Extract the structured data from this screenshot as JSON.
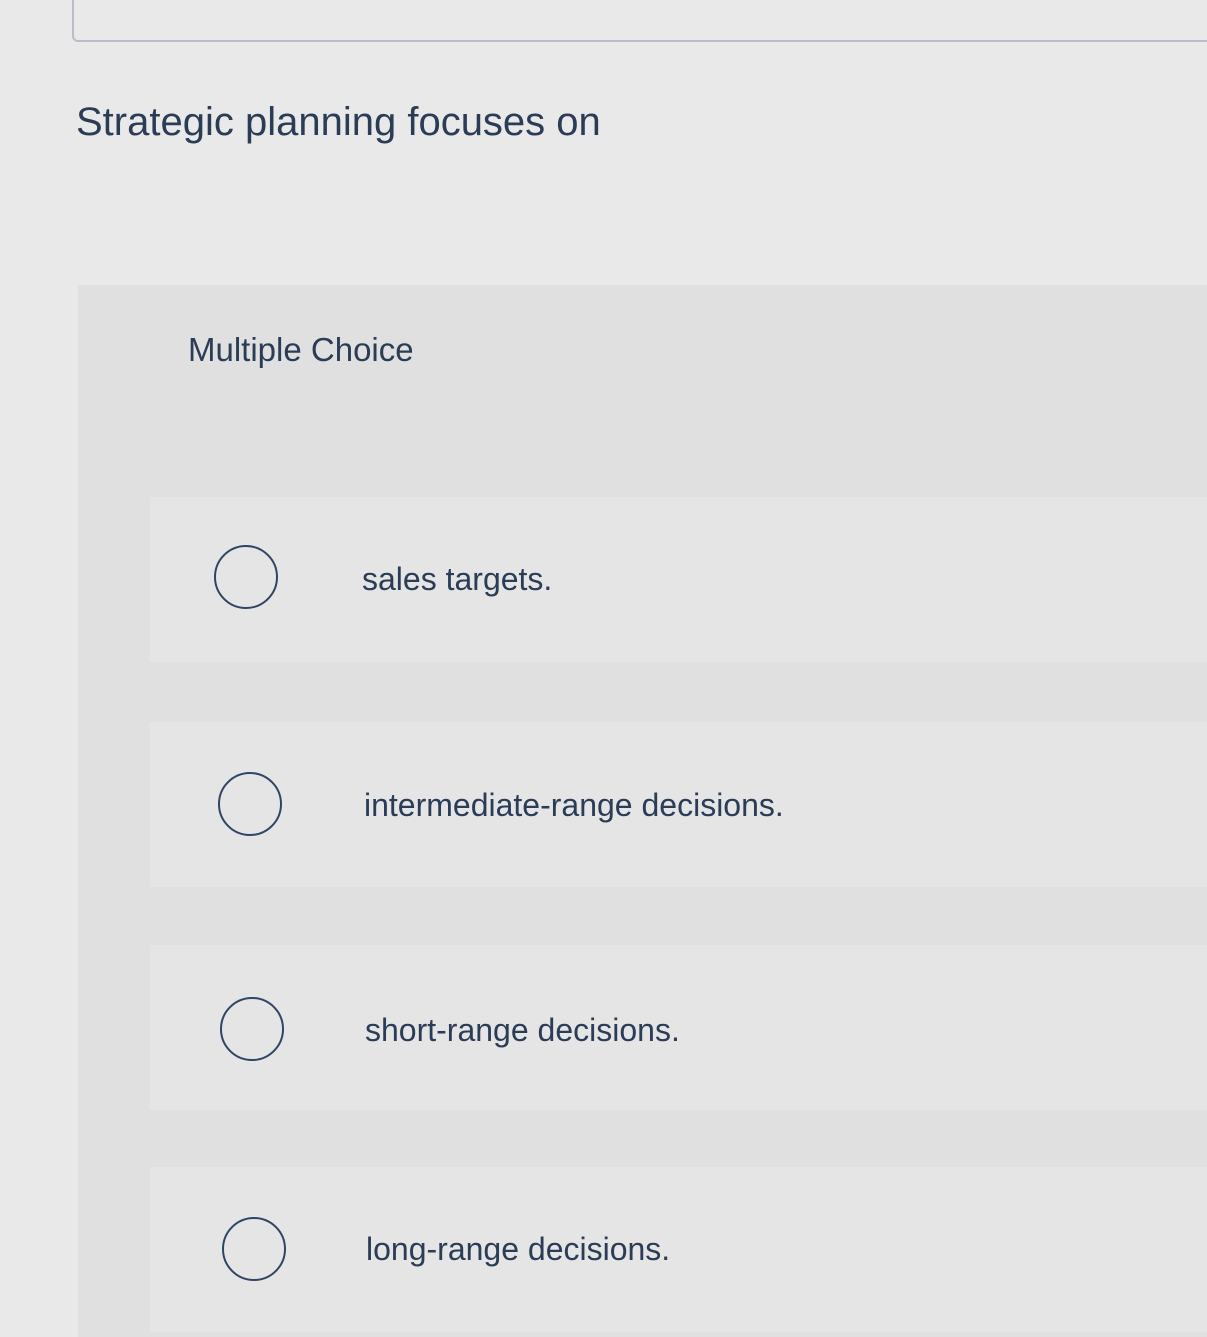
{
  "question": {
    "text": "Strategic planning focuses on"
  },
  "multiple_choice": {
    "title": "Multiple Choice",
    "options": [
      {
        "label": "sales targets.",
        "selected": false
      },
      {
        "label": "intermediate-range decisions.",
        "selected": false
      },
      {
        "label": "short-range decisions.",
        "selected": false
      },
      {
        "label": "long-range decisions.",
        "selected": false
      }
    ]
  }
}
